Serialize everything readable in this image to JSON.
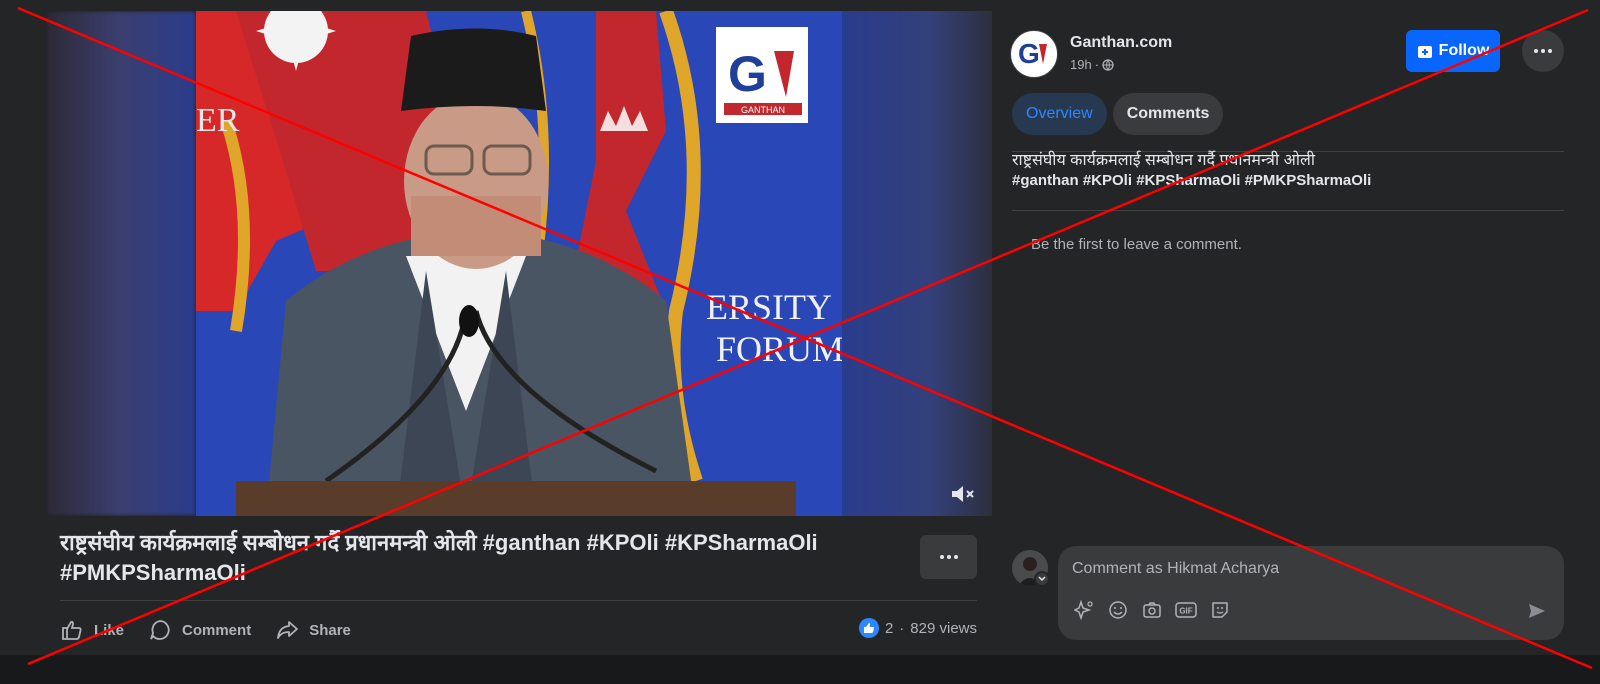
{
  "video": {
    "logo_text": "GANTHAN",
    "backdrop_text_top": "ER",
    "backdrop_text_mid": "ERSITY",
    "backdrop_text_low": "FORUM"
  },
  "post": {
    "caption": "राष्ट्रसंघीय कार्यक्रमलाई सम्बोधन गर्दै प्रधानमन्त्री ओली #ganthan #KPOli #KPSharmaOli #PMKPSharmaOli",
    "actions": {
      "like": "Like",
      "comment": "Comment",
      "share": "Share"
    },
    "reaction_count": "2",
    "separator": "·",
    "views": "829 views"
  },
  "page": {
    "name": "Ganthan.com",
    "time": "19h",
    "dot": "·",
    "follow_label": "Follow"
  },
  "tabs": [
    {
      "label": "Overview",
      "active": true
    },
    {
      "label": "Comments",
      "active": false
    }
  ],
  "description": {
    "text": "राष्ट्रसंघीय कार्यक्रमलाई सम्बोधन गर्दै प्रधानमन्त्री ओली",
    "tags": "#ganthan #KPOli #KPSharmaOli #PMKPSharmaOli"
  },
  "comments": {
    "empty_text": "Be the first to leave a comment.",
    "placeholder": "Comment as Hikmat Acharya",
    "gif_label": "GIF"
  },
  "colors": {
    "accent": "#0866ff",
    "overlay_x": "#ff0000"
  }
}
